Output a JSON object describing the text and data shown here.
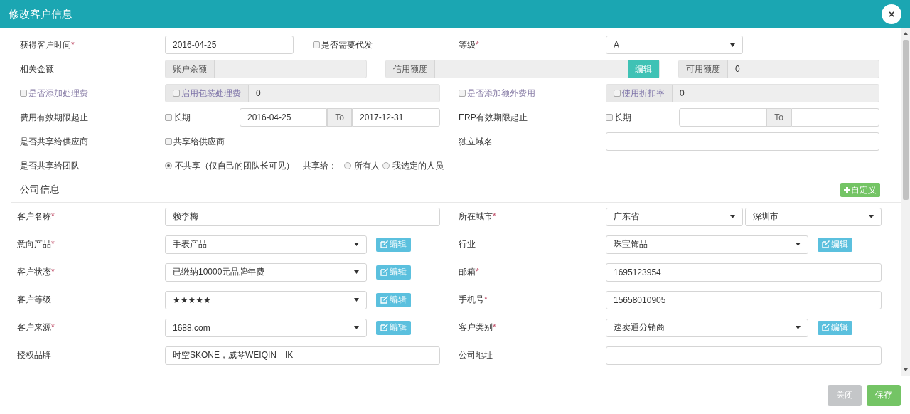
{
  "dialog": {
    "title": "修改客户信息",
    "close": "×"
  },
  "general": {
    "acquired_date": {
      "label": "获得客户时间",
      "mark": "*",
      "value": "2016-04-25"
    },
    "need_proxy": {
      "label": "是否需要代发",
      "checked": false
    },
    "grade": {
      "label": "等级",
      "mark": "*",
      "value": "A"
    },
    "amounts": {
      "label": "相关金额",
      "balance": {
        "label": "账户余额"
      },
      "credit": {
        "label": "信用额度",
        "button": "编辑"
      },
      "available": {
        "label": "可用额度",
        "value": "0"
      }
    },
    "handling_fee": {
      "label": "是否添加处理费",
      "checked": false,
      "disabled": true,
      "option": {
        "label": "启用包装处理费",
        "checked": false,
        "value": "0"
      }
    },
    "extra_fee": {
      "label": "是否添加额外费用",
      "checked": false,
      "disabled": true,
      "option": {
        "label": "使用折扣率",
        "checked": false,
        "value": "0"
      }
    },
    "fee_period": {
      "label": "费用有效期限起止",
      "long_term": {
        "label": "长期",
        "checked": false
      },
      "from": "2016-04-25",
      "to_label": "To",
      "to": "2017-12-31"
    },
    "erp_period": {
      "label": "ERP有效期限起止",
      "long_term": {
        "label": "长期",
        "checked": false
      },
      "to_label": "To"
    },
    "share_supplier": {
      "label": "是否共享给供应商",
      "option": {
        "label": "共享给供应商",
        "checked": false
      }
    },
    "domain": {
      "label": "独立域名"
    },
    "share_team": {
      "label": "是否共享给团队",
      "share_to": "共享给：",
      "options": [
        {
          "label": "不共享（仅自己的团队长可见）",
          "selected": true
        },
        {
          "label": "所有人",
          "selected": false
        },
        {
          "label": "我选定的人员",
          "selected": false
        }
      ]
    }
  },
  "company": {
    "title": "公司信息",
    "custom_button": "自定义",
    "rows": [
      {
        "left": {
          "label": "客户名称",
          "mark": "*",
          "kind": "text",
          "value": "赖李梅"
        },
        "right": {
          "label": "所在城市",
          "mark": "*",
          "kind": "select-pair",
          "values": [
            "广东省",
            "深圳市"
          ]
        }
      },
      {
        "left": {
          "label": "意向产品",
          "mark": "*",
          "kind": "select",
          "value": "手表产品",
          "edit": "编辑"
        },
        "right": {
          "label": "行业",
          "kind": "select",
          "value": "珠宝饰品",
          "edit": "编辑"
        }
      },
      {
        "left": {
          "label": "客户状态",
          "mark": "*",
          "kind": "select",
          "value": "已缴纳10000元品牌年费",
          "edit": "编辑"
        },
        "right": {
          "label": "邮箱",
          "mark": "*",
          "kind": "text",
          "value": "1695123954"
        }
      },
      {
        "left": {
          "label": "客户等级",
          "kind": "select",
          "value": "★★★★★",
          "edit": "编辑"
        },
        "right": {
          "label": "手机号",
          "mark": "*",
          "kind": "text",
          "value": "15658010905"
        }
      },
      {
        "left": {
          "label": "客户来源",
          "mark": "*",
          "kind": "select",
          "value": "1688.com",
          "edit": "编辑"
        },
        "right": {
          "label": "客户类别",
          "mark": "*",
          "kind": "select",
          "value": "速卖通分销商",
          "edit": "编辑"
        }
      },
      {
        "left": {
          "label": "授权品牌",
          "kind": "text",
          "value": "时空SKONE，威琴WEIQIN　IK"
        },
        "right": {
          "label": "公司地址",
          "kind": "text"
        }
      }
    ]
  },
  "footer": {
    "buttons": [
      {
        "label": "关闭",
        "kind": "close"
      },
      {
        "label": "保存",
        "kind": "save"
      }
    ]
  }
}
